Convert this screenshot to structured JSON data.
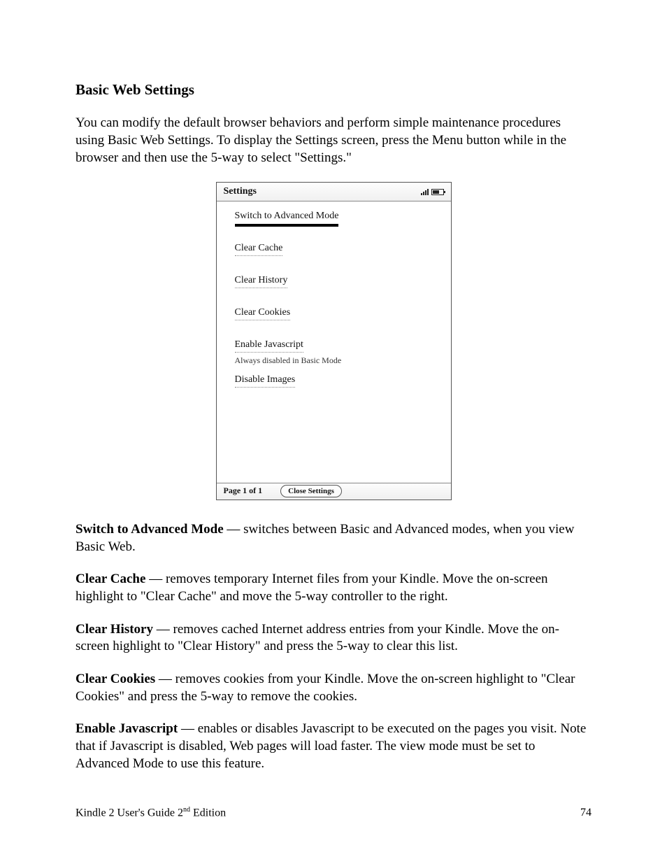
{
  "heading": "Basic Web Settings",
  "intro": "You can modify the default browser behaviors and perform simple maintenance procedures using Basic Web Settings. To display the Settings screen, press the Menu button while in the browser and then use the 5-way to select \"Settings.\"",
  "screenshot": {
    "title": "Settings",
    "items": {
      "switch": "Switch to Advanced Mode",
      "clear_cache": "Clear Cache",
      "clear_history": "Clear History",
      "clear_cookies": "Clear Cookies",
      "enable_js": "Enable Javascript",
      "enable_js_sub": "Always disabled in Basic Mode",
      "disable_images": "Disable Images"
    },
    "page_indicator": "Page 1 of 1",
    "close_label": "Close Settings"
  },
  "definitions": {
    "switch_term": "Switch to Advanced Mode",
    "switch_desc": " — switches between Basic and Advanced modes, when you view Basic Web.",
    "cache_term": "Clear Cache",
    "cache_desc": " — removes temporary Internet files from your Kindle. Move the on-screen highlight to \"Clear Cache\" and move the 5-way controller to the right.",
    "history_term": "Clear History",
    "history_desc": " — removes cached Internet address entries from your Kindle. Move the on-screen highlight to \"Clear History\" and press the 5-way to clear this list.",
    "cookies_term": "Clear Cookies",
    "cookies_desc": " — removes cookies from your Kindle. Move the on-screen highlight to \"Clear Cookies\" and press the 5-way to remove the cookies.",
    "js_term": "Enable Javascript",
    "js_desc": " — enables or disables Javascript to be executed on the pages you visit. Note that if Javascript is disabled, Web pages will load faster. The view mode must be set to Advanced Mode to use this feature."
  },
  "footer": {
    "guide_prefix": "Kindle 2 User's Guide 2",
    "guide_sup": "nd",
    "guide_suffix": " Edition",
    "page_number": "74"
  }
}
